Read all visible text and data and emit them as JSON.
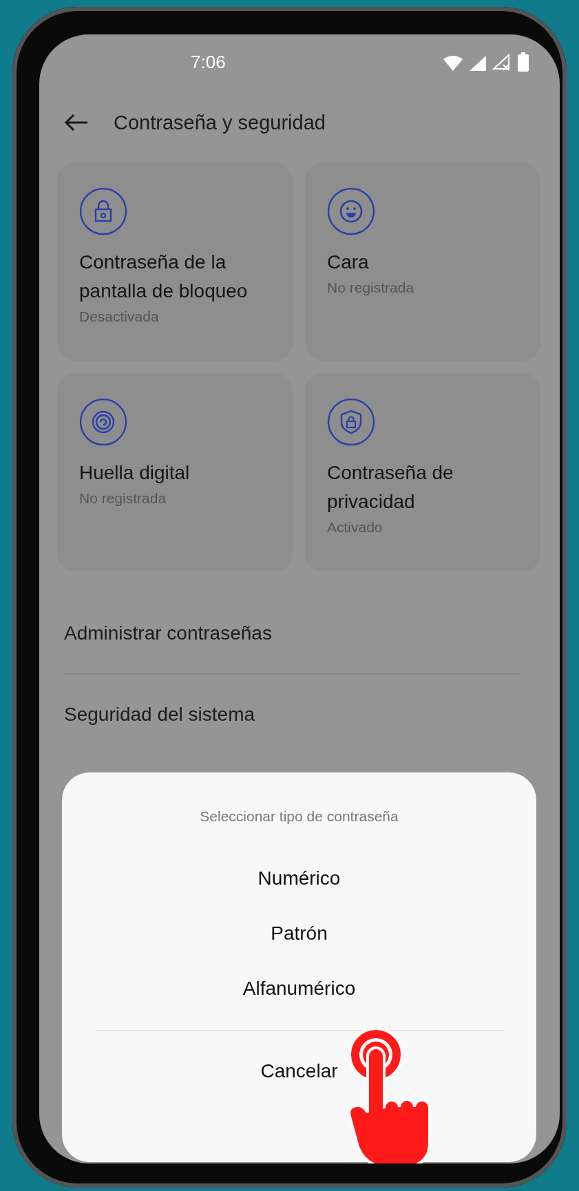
{
  "status_bar": {
    "time": "7:06"
  },
  "header": {
    "title": "Contraseña y seguridad"
  },
  "cards": [
    {
      "kind": "lock",
      "title": "Contraseña de la pantalla de bloqueo",
      "subtitle": "Desactivada"
    },
    {
      "kind": "face",
      "title": "Cara",
      "subtitle": "No registrada"
    },
    {
      "kind": "fingerprint",
      "title": "Huella digital",
      "subtitle": "No registrada"
    },
    {
      "kind": "shield",
      "title": "Contraseña de privacidad",
      "subtitle": "Activado"
    }
  ],
  "list_items": [
    {
      "label": "Administrar contraseñas"
    },
    {
      "label": "Seguridad del sistema"
    }
  ],
  "dialog": {
    "title": "Seleccionar tipo de contraseña",
    "options": [
      "Numérico",
      "Patrón",
      "Alfanumérico"
    ],
    "cancel": "Cancelar"
  }
}
